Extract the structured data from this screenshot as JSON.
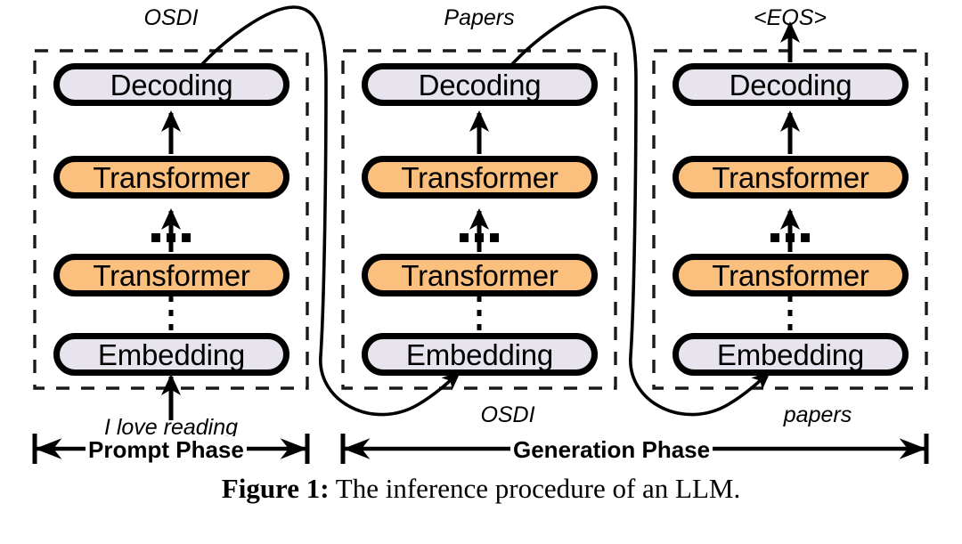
{
  "figure": {
    "caption_label": "Figure 1:",
    "caption_text": " The inference procedure of an LLM.",
    "background_color": "#ffffff",
    "stroke_color": "#000000"
  },
  "colors": {
    "decoding_fill": "#e7e4ee",
    "embedding_fill": "#e7e4ee",
    "transformer_fill": "#fbc07d",
    "outline": "#000000",
    "dashed_border": "#1a1a1a"
  },
  "columns": [
    {
      "id": "column-1",
      "phase": "prompt",
      "output_token": "OSDI",
      "input_token": "I love reading",
      "blocks": [
        {
          "id": "decoding",
          "label": "Decoding",
          "fill": "#e7e4ee"
        },
        {
          "id": "transformer-top",
          "label": "Transformer",
          "fill": "#fbc07d"
        },
        {
          "id": "ellipsis",
          "label": "...",
          "fill": null
        },
        {
          "id": "transformer-bottom",
          "label": "Transformer",
          "fill": "#fbc07d"
        },
        {
          "id": "embedding",
          "label": "Embedding",
          "fill": "#e7e4ee"
        }
      ]
    },
    {
      "id": "column-2",
      "phase": "generation",
      "output_token": "Papers",
      "input_token": "OSDI",
      "blocks": [
        {
          "id": "decoding",
          "label": "Decoding",
          "fill": "#e7e4ee"
        },
        {
          "id": "transformer-top",
          "label": "Transformer",
          "fill": "#fbc07d"
        },
        {
          "id": "ellipsis",
          "label": "...",
          "fill": null
        },
        {
          "id": "transformer-bottom",
          "label": "Transformer",
          "fill": "#fbc07d"
        },
        {
          "id": "embedding",
          "label": "Embedding",
          "fill": "#e7e4ee"
        }
      ]
    },
    {
      "id": "column-3",
      "phase": "generation",
      "output_token": "<EOS>",
      "input_token": "papers",
      "blocks": [
        {
          "id": "decoding",
          "label": "Decoding",
          "fill": "#e7e4ee"
        },
        {
          "id": "transformer-top",
          "label": "Transformer",
          "fill": "#fbc07d"
        },
        {
          "id": "ellipsis",
          "label": "...",
          "fill": null
        },
        {
          "id": "transformer-bottom",
          "label": "Transformer",
          "fill": "#fbc07d"
        },
        {
          "id": "embedding",
          "label": "Embedding",
          "fill": "#e7e4ee"
        }
      ]
    }
  ],
  "phases": [
    {
      "id": "prompt-phase",
      "label": "Prompt Phase"
    },
    {
      "id": "generation-phase",
      "label": "Generation Phase"
    }
  ],
  "flow_arrows": [
    {
      "from": "column-1.decoding",
      "to": "column-2.embedding",
      "token": "OSDI"
    },
    {
      "from": "column-2.decoding",
      "to": "column-3.embedding",
      "token": "Papers"
    },
    {
      "from": "column-3.decoding",
      "to": "output",
      "token": "<EOS>"
    }
  ]
}
